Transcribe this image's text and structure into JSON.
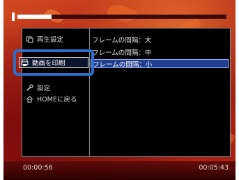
{
  "menu": {
    "left_items": [
      {
        "label": "再生設定",
        "icon": "playback-settings-icon"
      },
      {
        "label": "動画を印刷",
        "icon": "print-video-icon"
      },
      {
        "label": "設定",
        "icon": "wrench-icon"
      },
      {
        "label": "HOMEに戻る",
        "icon": "home-icon"
      }
    ],
    "right_items": [
      {
        "label": "フレームの間隔：大"
      },
      {
        "label": "フレームの間隔：中"
      },
      {
        "label": "フレームの間隔：小"
      }
    ],
    "selected_right_index": 2
  },
  "playback": {
    "current_time": "00:00:56",
    "total_time": "00:05:43",
    "progress_fraction": 0.163
  },
  "colors": {
    "highlight_border": "#2b6fcc",
    "selection_bg": "#1f3f8e",
    "panel_bg": "#000000"
  }
}
